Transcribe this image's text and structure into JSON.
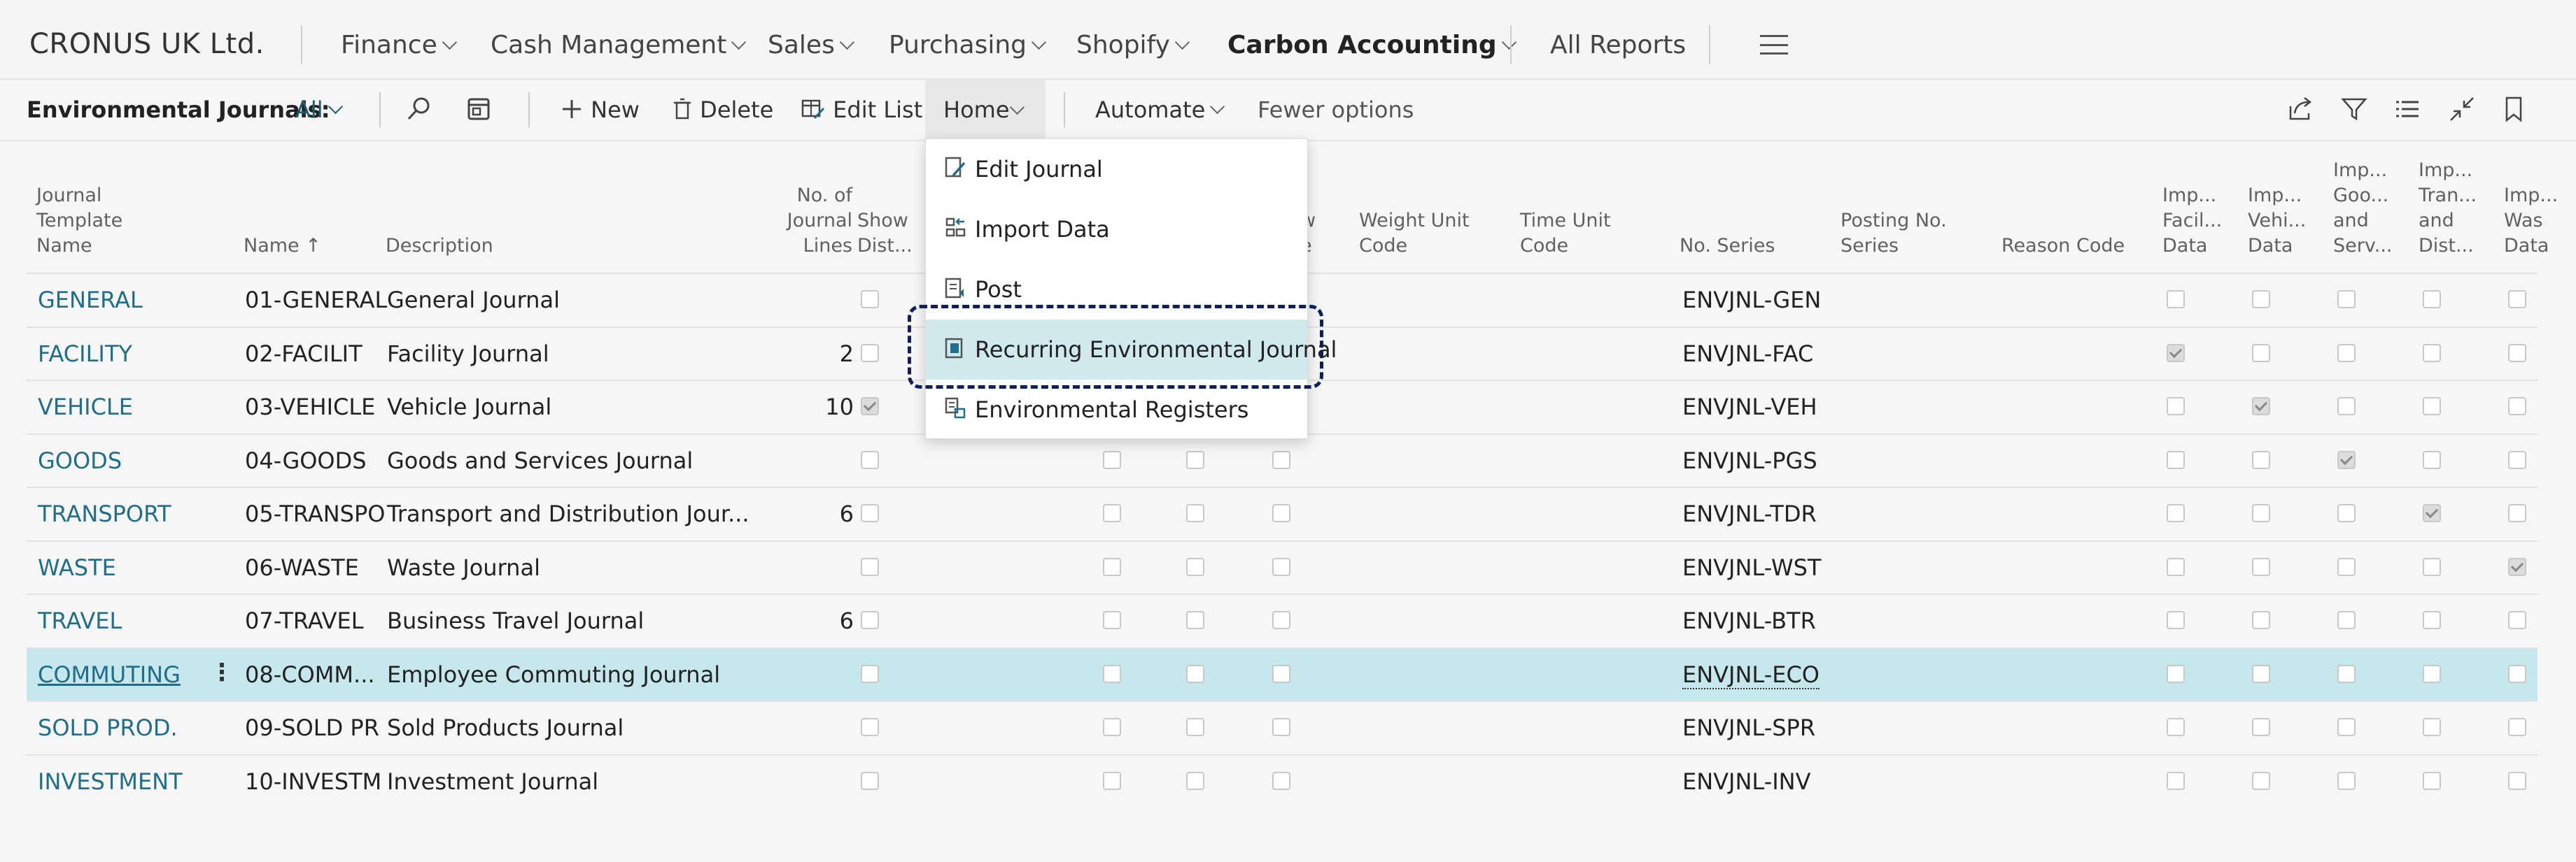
{
  "nav": {
    "company": "CRONUS UK Ltd.",
    "items": [
      {
        "label": "Finance"
      },
      {
        "label": "Cash Management"
      },
      {
        "label": "Sales"
      },
      {
        "label": "Purchasing"
      },
      {
        "label": "Shopify"
      },
      {
        "label": "Carbon Accounting"
      }
    ],
    "all_reports": "All Reports"
  },
  "actions": {
    "title": "Environmental Journals:",
    "filter": "All",
    "new": "New",
    "delete": "Delete",
    "edit_list": "Edit List",
    "home": "Home",
    "automate": "Automate",
    "fewer_options": "Fewer options"
  },
  "menu": {
    "items": [
      {
        "label": "Edit Journal",
        "icon": "edit-journal-icon"
      },
      {
        "label": "Import Data",
        "icon": "import-data-icon"
      },
      {
        "label": "Post",
        "icon": "post-icon"
      },
      {
        "label": "Recurring Environmental Journal",
        "icon": "recurring-journal-icon"
      },
      {
        "label": "Environmental Registers",
        "icon": "registers-icon"
      }
    ]
  },
  "columns": {
    "template_name": [
      "Journal",
      "Template",
      "Name"
    ],
    "name": "Name",
    "description": "Description",
    "no_lines": [
      "No. of",
      "Journal",
      "Lines"
    ],
    "show_dist": [
      "Show",
      "Dist..."
    ],
    "col_w": [
      "w",
      "e"
    ],
    "weight_unit": [
      "Weight Unit",
      "Code"
    ],
    "time_unit": [
      "Time Unit",
      "Code"
    ],
    "no_series": "No. Series",
    "posting_no_series": [
      "Posting No.",
      "Series"
    ],
    "reason_code": "Reason Code",
    "imp_facil": [
      "Imp...",
      "Facil...",
      "Data"
    ],
    "imp_vehi": [
      "Imp...",
      "Vehi...",
      "Data"
    ],
    "imp_goods": [
      "Imp...",
      "Goo...",
      "and",
      "Serv..."
    ],
    "imp_tran": [
      "Imp...",
      "Tran...",
      "and",
      "Dist..."
    ],
    "imp_was": [
      "Imp...",
      "Was",
      "Data"
    ]
  },
  "rows": [
    {
      "template": "GENERAL",
      "name": "01-GENERAL",
      "description": "General Journal",
      "lines": "",
      "show_dist": false,
      "no_series": "ENVJNL-GEN",
      "imp": [
        false,
        false,
        false,
        false,
        false
      ]
    },
    {
      "template": "FACILITY",
      "name": "02-FACILIT",
      "description": "Facility Journal",
      "lines": "2",
      "show_dist": false,
      "no_series": "ENVJNL-FAC",
      "imp": [
        true,
        false,
        false,
        false,
        false
      ]
    },
    {
      "template": "VEHICLE",
      "name": "03-VEHICLE",
      "description": "Vehicle Journal",
      "lines": "10",
      "show_dist": true,
      "no_series": "ENVJNL-VEH",
      "imp": [
        false,
        true,
        false,
        false,
        false
      ]
    },
    {
      "template": "GOODS",
      "name": "04-GOODS",
      "description": "Goods and Services Journal",
      "lines": "",
      "show_dist": false,
      "no_series": "ENVJNL-PGS",
      "imp": [
        false,
        false,
        true,
        false,
        false
      ]
    },
    {
      "template": "TRANSPORT",
      "name": "05-TRANSPO",
      "description": "Transport and Distribution Jour...",
      "lines": "6",
      "show_dist": false,
      "no_series": "ENVJNL-TDR",
      "imp": [
        false,
        false,
        false,
        true,
        false
      ]
    },
    {
      "template": "WASTE",
      "name": "06-WASTE",
      "description": "Waste Journal",
      "lines": "",
      "show_dist": false,
      "no_series": "ENVJNL-WST",
      "imp": [
        false,
        false,
        false,
        false,
        true
      ]
    },
    {
      "template": "TRAVEL",
      "name": "07-TRAVEL",
      "description": "Business Travel Journal",
      "lines": "6",
      "show_dist": false,
      "no_series": "ENVJNL-BTR",
      "imp": [
        false,
        false,
        false,
        false,
        false
      ]
    },
    {
      "template": "COMMUTING",
      "name": "08-COMM...",
      "description": "Employee Commuting Journal",
      "lines": "",
      "show_dist": false,
      "no_series": "ENVJNL-ECO",
      "imp": [
        false,
        false,
        false,
        false,
        false
      ]
    },
    {
      "template": "SOLD PROD.",
      "name": "09-SOLD PR",
      "description": "Sold Products Journal",
      "lines": "",
      "show_dist": false,
      "no_series": "ENVJNL-SPR",
      "imp": [
        false,
        false,
        false,
        false,
        false
      ]
    },
    {
      "template": "INVESTMENT",
      "name": "10-INVESTM",
      "description": "Investment Journal",
      "lines": "",
      "show_dist": false,
      "no_series": "ENVJNL-INV",
      "imp": [
        false,
        false,
        false,
        false,
        false
      ]
    }
  ],
  "selected_row_index": 7,
  "colors": {
    "accent": "#1f6e8c",
    "selected_row": "#c6e7eb",
    "focus_ring": "#0e1f5e"
  }
}
